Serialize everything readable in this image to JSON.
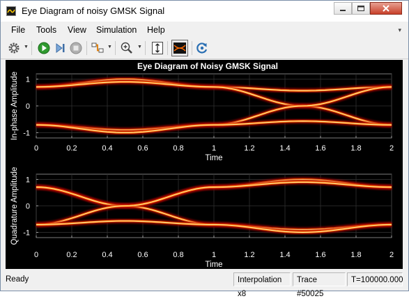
{
  "window": {
    "title": "Eye Diagram of noisy GMSK Signal"
  },
  "menu": {
    "items": [
      "File",
      "Tools",
      "View",
      "Simulation",
      "Help"
    ]
  },
  "toolbar": {
    "buttons": [
      "settings",
      "run",
      "step-forward",
      "stop",
      "highlight-signal",
      "zoom-in",
      "scale-y-axis",
      "eye-diagram-view",
      "restore-defaults"
    ]
  },
  "plot": {
    "title": "Eye Diagram of Noisy GMSK Signal",
    "colors": {
      "background": "#000000",
      "trace_core": "#fff0a0",
      "trace_mid": "#ff6a00",
      "trace_glow": "#b00000",
      "axis_text": "#ffffff"
    }
  },
  "chart_data": [
    {
      "type": "line",
      "title": "Eye Diagram of Noisy GMSK Signal",
      "xlabel": "Time",
      "ylabel": "In-phase Amplitude",
      "xlim": [
        0,
        2
      ],
      "ylim": [
        -1.2,
        1.2
      ],
      "xticks": [
        "0",
        "0.2",
        "0.4",
        "0.6",
        "0.8",
        "1",
        "1.2",
        "1.4",
        "1.6",
        "1.8",
        "2"
      ],
      "yticks": [
        "1",
        "0",
        "-1"
      ],
      "grid": true,
      "series": [
        {
          "x": [
            0,
            0.5,
            1,
            1.5,
            2
          ],
          "y": [
            0.71,
            1.0,
            0.71,
            0.57,
            0.71
          ]
        },
        {
          "x": [
            0,
            0.5,
            1,
            1.5,
            2
          ],
          "y": [
            0.71,
            0.9,
            0.71,
            0.0,
            -0.71
          ]
        },
        {
          "x": [
            0,
            0.5,
            1,
            1.5,
            2
          ],
          "y": [
            -0.71,
            -0.9,
            -0.71,
            0.0,
            0.71
          ]
        },
        {
          "x": [
            0,
            0.5,
            1,
            1.5,
            2
          ],
          "y": [
            -0.71,
            -1.0,
            -0.71,
            -0.57,
            -0.71
          ]
        }
      ]
    },
    {
      "type": "line",
      "title": "",
      "xlabel": "Time",
      "ylabel": "Quadrature Amplitude",
      "xlim": [
        0,
        2
      ],
      "ylim": [
        -1.2,
        1.2
      ],
      "xticks": [
        "0",
        "0.2",
        "0.4",
        "0.6",
        "0.8",
        "1",
        "1.2",
        "1.4",
        "1.6",
        "1.8",
        "2"
      ],
      "yticks": [
        "1",
        "0",
        "-1"
      ],
      "grid": true,
      "series": [
        {
          "x": [
            0,
            0.5,
            1,
            1.5,
            2
          ],
          "y": [
            0.71,
            0.0,
            0.71,
            1.0,
            0.71
          ]
        },
        {
          "x": [
            0,
            0.5,
            1,
            1.5,
            2
          ],
          "y": [
            0.71,
            0.0,
            -0.71,
            -0.9,
            -0.71
          ]
        },
        {
          "x": [
            0,
            0.5,
            1,
            1.5,
            2
          ],
          "y": [
            -0.71,
            0.0,
            0.71,
            0.9,
            0.71
          ]
        },
        {
          "x": [
            0,
            0.5,
            1,
            1.5,
            2
          ],
          "y": [
            -0.71,
            -0.57,
            -0.71,
            -1.0,
            -0.71
          ]
        }
      ]
    }
  ],
  "status": {
    "ready": "Ready",
    "interpolation": "Interpolation x8",
    "trace": "Trace #50025",
    "time": "T=100000.000"
  }
}
